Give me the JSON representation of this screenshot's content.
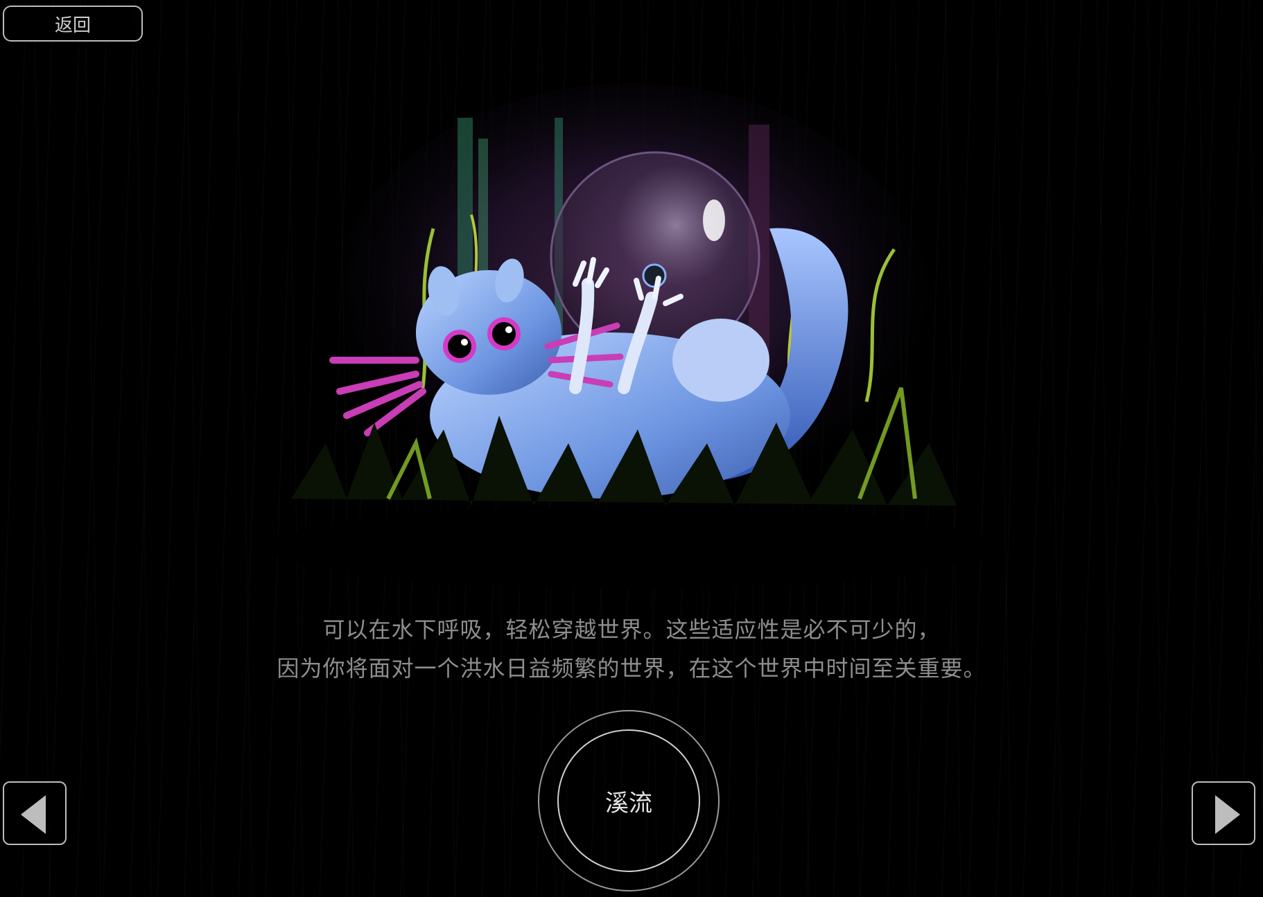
{
  "header": {
    "back_label": "返回"
  },
  "story": {
    "line1": "可以在水下呼吸，轻松穿越世界。这些适应性是必不可少的，",
    "line2": "因为你将面对一个洪水日益频繁的世界，在这个世界中时间至关重要。"
  },
  "selector": {
    "current_label": "溪流"
  },
  "icons": {
    "prev": "triangle-left-icon",
    "next": "triangle-right-icon"
  },
  "colors": {
    "background": "#000000",
    "text": "#8e8e8e",
    "creature": "#7fa7e8",
    "accent_pink": "#c93db6",
    "accent_green": "#9bbf36"
  }
}
